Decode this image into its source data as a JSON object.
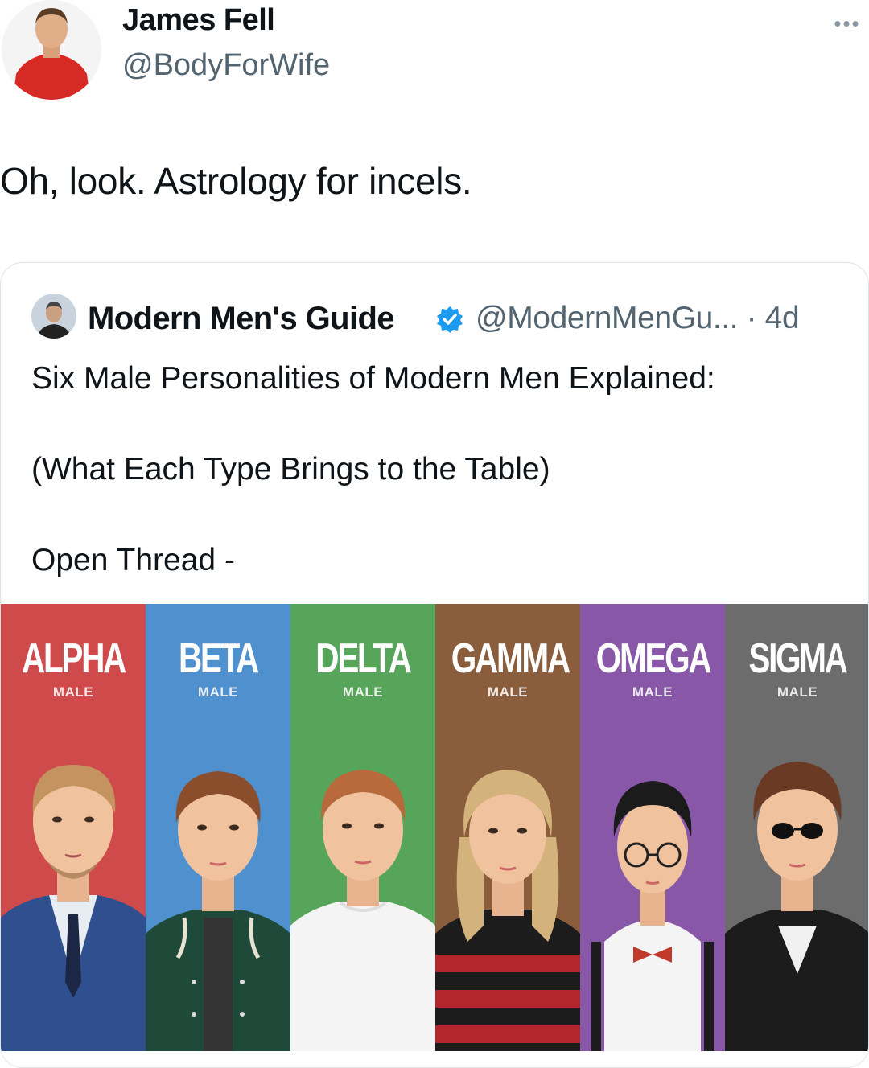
{
  "author": {
    "name": "James Fell",
    "handle": "@BodyForWife",
    "more_icon": "more-dots-icon"
  },
  "tweet": {
    "text": "Oh, look. Astrology for incels."
  },
  "quote": {
    "name": "Modern Men's Guide",
    "verified_icon": "verified-badge-icon",
    "handle_and_time": "@ModernMenGu... · 4d",
    "lines": [
      "Six Male Personalities of Modern Men Explained:",
      "(What Each Type Brings to the Table)",
      "Open Thread -"
    ],
    "panels": [
      {
        "title": "ALPHA",
        "sub": "MALE",
        "color": "#cf4b4b"
      },
      {
        "title": "BETA",
        "sub": "MALE",
        "color": "#4f90cf"
      },
      {
        "title": "DELTA",
        "sub": "MALE",
        "color": "#57a55a"
      },
      {
        "title": "GAMMA",
        "sub": "MALE",
        "color": "#8a5e3c"
      },
      {
        "title": "OMEGA",
        "sub": "MALE",
        "color": "#8857a7"
      },
      {
        "title": "SIGMA",
        "sub": "MALE",
        "color": "#6c6c6c"
      }
    ]
  }
}
